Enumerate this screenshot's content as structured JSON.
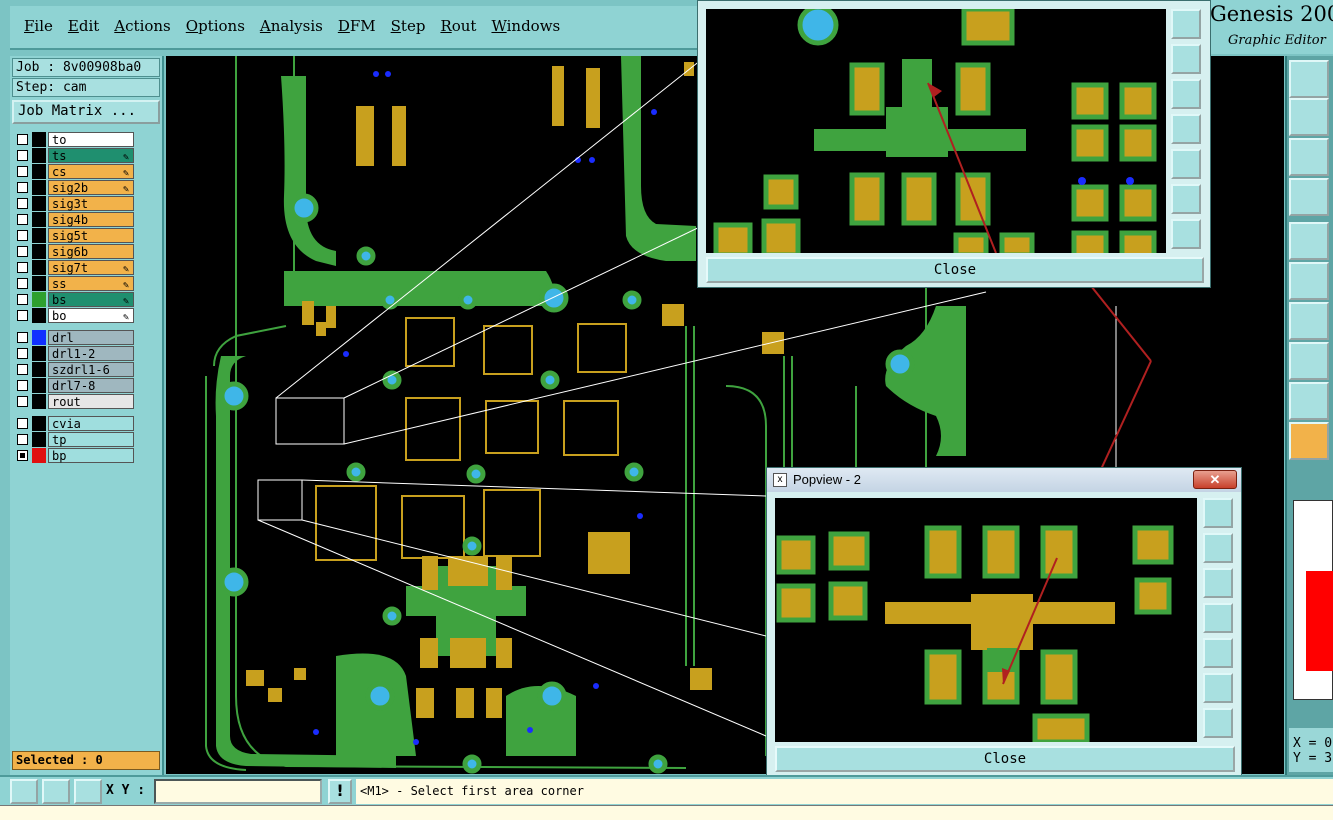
{
  "menu": {
    "items": [
      {
        "label": "File",
        "u": "F",
        "rest": "ile"
      },
      {
        "label": "Edit",
        "u": "E",
        "rest": "dit"
      },
      {
        "label": "Actions",
        "u": "A",
        "rest": "ctions"
      },
      {
        "label": "Options",
        "u": "O",
        "rest": "ptions"
      },
      {
        "label": "Analysis",
        "u": "A",
        "rest": "nalysis"
      },
      {
        "label": "DFM",
        "u": "D",
        "rest": "FM"
      },
      {
        "label": "Step",
        "u": "S",
        "rest": "tep"
      },
      {
        "label": "Rout",
        "u": "R",
        "rest": "out"
      },
      {
        "label": "Windows",
        "u": "W",
        "rest": "indows"
      }
    ]
  },
  "branding": {
    "title": "Genesis 200",
    "subtitle": "Graphic Editor"
  },
  "job": {
    "job_line": "Job : 8v00908ba0",
    "step_line": "Step: cam",
    "matrix_button": "Job Matrix ..."
  },
  "layers": [
    {
      "name": "to",
      "color": "#ffffff",
      "swatch": "#000000",
      "editable": false
    },
    {
      "name": "ts",
      "color": "#1f8f6f",
      "swatch": "#000000",
      "editable": true
    },
    {
      "name": "cs",
      "color": "#f2b24a",
      "swatch": "#000000",
      "editable": true
    },
    {
      "name": "sig2b",
      "color": "#f2b24a",
      "swatch": "#000000",
      "editable": true
    },
    {
      "name": "sig3t",
      "color": "#f2b24a",
      "swatch": "#000000",
      "editable": false
    },
    {
      "name": "sig4b",
      "color": "#f2b24a",
      "swatch": "#000000",
      "editable": false
    },
    {
      "name": "sig5t",
      "color": "#f2b24a",
      "swatch": "#000000",
      "editable": false
    },
    {
      "name": "sig6b",
      "color": "#f2b24a",
      "swatch": "#000000",
      "editable": false
    },
    {
      "name": "sig7t",
      "color": "#f2b24a",
      "swatch": "#000000",
      "editable": true
    },
    {
      "name": "ss",
      "color": "#f2b24a",
      "swatch": "#000000",
      "editable": true
    },
    {
      "name": "bs",
      "color": "#1f8f6f",
      "swatch": "#2ea02e",
      "editable": true
    },
    {
      "name": "bo",
      "color": "#ffffff",
      "swatch": "#000000",
      "editable": true
    },
    {
      "name": "drl",
      "color": "#9fb7bf",
      "swatch": "#1030ff",
      "editable": false
    },
    {
      "name": "drl1-2",
      "color": "#9fb7bf",
      "swatch": "#000000",
      "editable": false
    },
    {
      "name": "szdrl1-6",
      "color": "#9fb7bf",
      "swatch": "#000000",
      "editable": false
    },
    {
      "name": "drl7-8",
      "color": "#9fb7bf",
      "swatch": "#000000",
      "editable": false
    },
    {
      "name": "rout",
      "color": "#e6e6e6",
      "swatch": "#000000",
      "editable": false
    },
    {
      "name": "cvia",
      "color": "#9fdede",
      "swatch": "#000000",
      "editable": false
    },
    {
      "name": "tp",
      "color": "#9fdede",
      "swatch": "#000000",
      "editable": false
    },
    {
      "name": "bp",
      "color": "#9fdede",
      "swatch": "#e01010",
      "editable": false,
      "checked": true
    }
  ],
  "selected": "Selected : 0",
  "status": {
    "xy_label": "X Y :",
    "xy_value": "",
    "prompt": "<M1> - Select first area corner",
    "excl": "!"
  },
  "coords": {
    "x": "X = 0",
    "y": "Y = 3"
  },
  "popview1": {
    "close": "Close"
  },
  "popview2": {
    "title": "Popview - 2",
    "close": "Close",
    "close_x": "✕"
  },
  "colors": {
    "copper": "#c8a01e",
    "mask": "#3fa33f",
    "via": "#3fb6e8",
    "drill": "#1a2cff",
    "board": "#000000"
  },
  "icons": [
    "zoom-in-icon",
    "zoom-home-icon",
    "zoom-fit-icon",
    "pan-icon"
  ]
}
